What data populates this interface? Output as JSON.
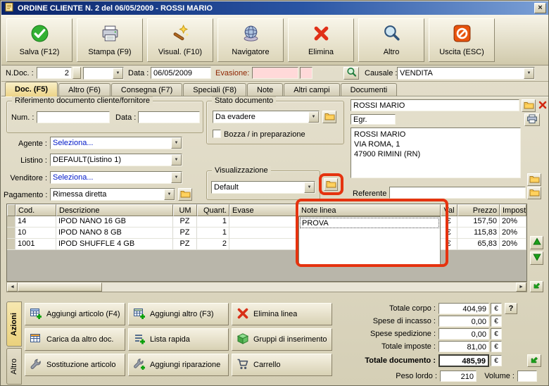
{
  "icons": {
    "dropdown": "▼",
    "scroll_left": "◄",
    "scroll_right": "►",
    "close": "×",
    "help": "?"
  },
  "titlebar": {
    "title": "ORDINE CLIENTE N. 2  del 06/05/2009 - ROSSI MARIO"
  },
  "toolbar": {
    "buttons": [
      {
        "label": "Salva (F12)"
      },
      {
        "label": "Stampa (F9)"
      },
      {
        "label": "Visual. (F10)"
      },
      {
        "label": "Navigatore"
      },
      {
        "label": "Elimina"
      },
      {
        "label": "Altro"
      },
      {
        "label": "Uscita (ESC)"
      }
    ]
  },
  "docbar": {
    "ndoc_label": "N.Doc. :",
    "ndoc_value": "2",
    "data_label": "Data :",
    "data_value": "06/05/2009",
    "evasione_label": "Evasione:",
    "evasione_value": "",
    "causale_label": "Causale :",
    "causale_value": "VENDITA"
  },
  "tabs": [
    {
      "label": "Doc. (F5)"
    },
    {
      "label": "Altro (F6)"
    },
    {
      "label": "Consegna (F7)"
    },
    {
      "label": "Speciali (F8)"
    },
    {
      "label": "Note"
    },
    {
      "label": "Altri campi"
    },
    {
      "label": "Documenti"
    }
  ],
  "riferimento": {
    "legend": "Riferimento documento cliente/fornitore",
    "num_label": "Num. :",
    "num_value": "",
    "data_label": "Data :",
    "data_value": ""
  },
  "anagrafica": {
    "agente_label": "Agente :",
    "agente_value": "Seleziona...",
    "listino_label": "Listino :",
    "listino_value": "DEFAULT(Listino 1)",
    "venditore_label": "Venditore :",
    "venditore_value": "Seleziona...",
    "pagamento_label": "Pagamento :",
    "pagamento_value": "Rimessa diretta"
  },
  "stato": {
    "legend": "Stato documento",
    "value": "Da evadere",
    "bozza_label": "Bozza / in preparazione"
  },
  "visualizzazione": {
    "legend": "Visualizzazione",
    "value": "Default"
  },
  "cliente": {
    "nome": "ROSSI MARIO",
    "titolo": "Egr.",
    "indirizzo_1": "ROSSI MARIO",
    "indirizzo_2": "VIA ROMA, 1",
    "indirizzo_3": "47900 RIMINI (RN)",
    "referente_label": "Referente",
    "referente_value": ""
  },
  "grid": {
    "headers": [
      "Cod.",
      "Descrizione",
      "UM",
      "Quant.",
      "Evase",
      "Note linea",
      "Val",
      "Prezzo",
      "Imposte"
    ],
    "rows": [
      {
        "cod": "14",
        "descrizione": "IPOD NANO 16 GB",
        "um": "PZ",
        "quant": "1",
        "evase": "",
        "note": "PROVA",
        "val": "€",
        "prezzo": "157,50",
        "imposte": "20%"
      },
      {
        "cod": "10",
        "descrizione": "IPOD NANO 8 GB",
        "um": "PZ",
        "quant": "1",
        "evase": "",
        "note": "",
        "val": "€",
        "prezzo": "115,83",
        "imposte": "20%"
      },
      {
        "cod": "1001",
        "descrizione": "IPOD SHUFFLE 4 GB",
        "um": "PZ",
        "quant": "2",
        "evase": "",
        "note": "",
        "val": "€",
        "prezzo": "65,83",
        "imposte": "20%"
      }
    ]
  },
  "azioni": {
    "tab_azioni": "Azioni",
    "tab_altro": "Altro",
    "buttons": [
      {
        "label": "Aggiungi articolo (F4)"
      },
      {
        "label": "Aggiungi altro (F3)"
      },
      {
        "label": "Elimina linea"
      },
      {
        "label": "Carica da altro doc."
      },
      {
        "label": "Lista rapida"
      },
      {
        "label": "Gruppi di inserimento"
      },
      {
        "label": "Sostituzione articolo"
      },
      {
        "label": "Aggiungi riparazione"
      },
      {
        "label": "Carrello"
      }
    ]
  },
  "totali": {
    "rows": [
      {
        "label": "Totale corpo :",
        "value": "404,99",
        "currency": "€"
      },
      {
        "label": "Spese di incasso :",
        "value": "0,00",
        "currency": "€"
      },
      {
        "label": "Spese spedizione :",
        "value": "0,00",
        "currency": "€"
      },
      {
        "label": "Totale imposte :",
        "value": "81,00",
        "currency": "€"
      },
      {
        "label": "Totale documento :",
        "value": "485,99",
        "currency": "€"
      }
    ],
    "peso_label": "Peso lordo :",
    "peso_value": "210",
    "volume_label": "Volume :",
    "volume_value": ""
  }
}
